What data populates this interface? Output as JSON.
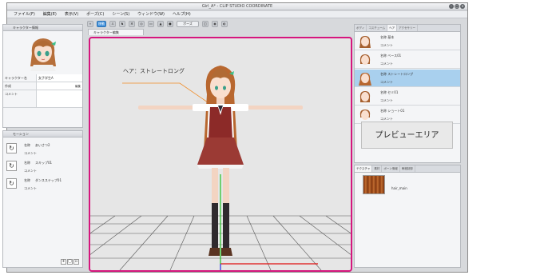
{
  "window": {
    "title": "Girl_A* - CLIP STUDIO COORDINATE"
  },
  "menu": [
    "ファイル(F)",
    "編集(E)",
    "表示(V)",
    "ポーズ(C)",
    "シーン(S)",
    "ウィンドウ(W)",
    "ヘルプ(H)"
  ],
  "toolbar": {
    "move_label": "移動",
    "pose_label": "ポーズ"
  },
  "left_panel": {
    "tab_label": "キャラクター情報",
    "props": [
      {
        "key": "キャラクター名",
        "value": "女子学生A"
      },
      {
        "key": "作成",
        "value": ""
      },
      {
        "key": "コメント",
        "value": ""
      }
    ],
    "edit_label": "編集"
  },
  "motion_panel": {
    "tab_label": "モーション",
    "items": [
      {
        "name_label": "名称",
        "name": "あいさつ2",
        "comment_label": "コメント"
      },
      {
        "name_label": "名称",
        "name": "スキップ01",
        "comment_label": "コメント"
      },
      {
        "name_label": "名称",
        "name": "ダンスステップ01",
        "comment_label": "コメント"
      }
    ]
  },
  "doc_tab": {
    "label": "キャラクター編集"
  },
  "preview": {
    "label": "ヘア：ストレートロング"
  },
  "right_panel": {
    "tabs": [
      "ボディ",
      "コスチューム",
      "ヘア",
      "アクセサリー"
    ],
    "active_tab": 2,
    "items": [
      {
        "name_label": "名称",
        "name": "基本",
        "comment_label": "コメント"
      },
      {
        "name_label": "名称",
        "name": "ベース01",
        "comment_label": "コメント"
      },
      {
        "name_label": "名称",
        "name": "ストレートロング",
        "comment_label": "コメント",
        "selected": true
      },
      {
        "name_label": "名称",
        "name": "セミ01",
        "comment_label": "コメント"
      },
      {
        "name_label": "名称",
        "name": "ショート01",
        "comment_label": "コメント"
      }
    ]
  },
  "texture_panel": {
    "tabs": [
      "テクスチャ",
      "素材",
      "ボーン情報",
      "骨格制御"
    ],
    "item_name": "hair_main"
  },
  "callout": {
    "text": "プレビューエリア"
  },
  "colors": {
    "highlight": "#d6167e",
    "selected_row": "#a9d0ee"
  }
}
